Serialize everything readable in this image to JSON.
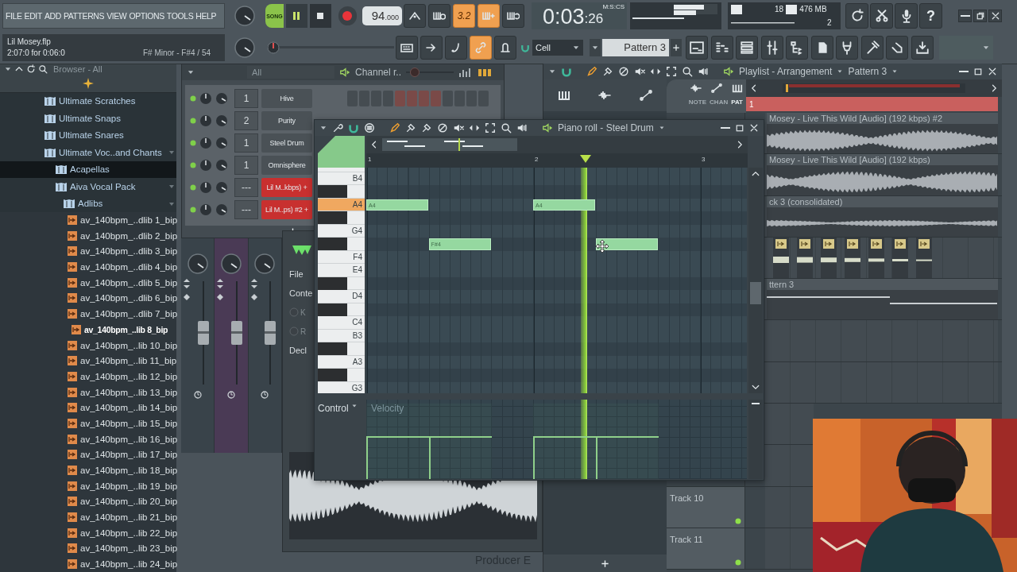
{
  "menu": [
    "FILE",
    "EDIT",
    "ADD",
    "PATTERNS",
    "VIEW",
    "OPTIONS",
    "TOOLS",
    "HELP"
  ],
  "project": {
    "file": "Lil Mosey.flp",
    "position": "2:07:0 for 0:06:0",
    "scale": "F# Minor - F#4 / 54"
  },
  "transport": {
    "mode": "SONG",
    "song_mode": true,
    "playing": true,
    "tempo": "94",
    "tempo_fraction": ".000"
  },
  "tools_top": [
    {
      "on": false
    },
    {
      "on": false
    },
    {
      "label": "3.2",
      "on": true
    },
    {
      "on": true
    },
    {
      "on": false
    }
  ],
  "tools_bottom": [
    {
      "on": false
    },
    {
      "on": false
    },
    {
      "on": false
    },
    {
      "on": true
    },
    {
      "on": false
    }
  ],
  "clock": {
    "time": "0:03",
    "centiseconds": ":26",
    "format": "M:S:CS"
  },
  "cpu": {
    "polyphony": "18",
    "memory": "476 MB",
    "processes": "2"
  },
  "help": "?",
  "pitch_slider": {
    "level": 0.0
  },
  "snap": "Cell",
  "pattern": "Pattern 3",
  "browser": {
    "title": "Browser - All",
    "tree": [
      {
        "label": "Ultimate Scratches",
        "kind": "folder",
        "selected": false
      },
      {
        "label": "Ultimate Snaps",
        "kind": "folder",
        "selected": false
      },
      {
        "label": "Ultimate Snares",
        "kind": "folder",
        "selected": false
      },
      {
        "label": "Ultimate Voc..and Chants",
        "kind": "folder",
        "selected": false,
        "expanded": true,
        "children": [
          {
            "label": "Acapellas",
            "kind": "folder",
            "selected": true
          },
          {
            "label": "Aiva Vocal Pack",
            "kind": "folder",
            "selected": false,
            "expanded": true,
            "children": [
              {
                "label": "Adlibs",
                "kind": "folder",
                "selected": false,
                "expanded": true,
                "children": [
                  {
                    "label": "av_140bpm_..dlib 1_bip",
                    "kind": "file",
                    "selected": false
                  },
                  {
                    "label": "av_140bpm_..dlib 2_bip",
                    "kind": "file",
                    "selected": false
                  },
                  {
                    "label": "av_140bpm_..dlib 3_bip",
                    "kind": "file",
                    "selected": false
                  },
                  {
                    "label": "av_140bpm_..dlib 4_bip",
                    "kind": "file",
                    "selected": false
                  },
                  {
                    "label": "av_140bpm_..dlib 5_bip",
                    "kind": "file",
                    "selected": false
                  },
                  {
                    "label": "av_140bpm_..dlib 6_bip",
                    "kind": "file",
                    "selected": false
                  },
                  {
                    "label": "av_140bpm_..dlib 7_bip",
                    "kind": "file",
                    "selected": false
                  },
                  {
                    "label": "av_140bpm_..lib 8_bip",
                    "kind": "file",
                    "selected": true
                  },
                  {
                    "label": "av_140bpm_..lib 10_bip",
                    "kind": "file",
                    "selected": false
                  },
                  {
                    "label": "av_140bpm_..lib 11_bip",
                    "kind": "file",
                    "selected": false
                  },
                  {
                    "label": "av_140bpm_..lib 12_bip",
                    "kind": "file",
                    "selected": false
                  },
                  {
                    "label": "av_140bpm_..lib 13_bip",
                    "kind": "file",
                    "selected": false
                  },
                  {
                    "label": "av_140bpm_..lib 14_bip",
                    "kind": "file",
                    "selected": false
                  },
                  {
                    "label": "av_140bpm_..lib 15_bip",
                    "kind": "file",
                    "selected": false
                  },
                  {
                    "label": "av_140bpm_..lib 16_bip",
                    "kind": "file",
                    "selected": false
                  },
                  {
                    "label": "av_140bpm_..lib 17_bip",
                    "kind": "file",
                    "selected": false
                  },
                  {
                    "label": "av_140bpm_..lib 18_bip",
                    "kind": "file",
                    "selected": false
                  },
                  {
                    "label": "av_140bpm_..lib 19_bip",
                    "kind": "file",
                    "selected": false
                  },
                  {
                    "label": "av_140bpm_..lib 20_bip",
                    "kind": "file",
                    "selected": false
                  },
                  {
                    "label": "av_140bpm_..lib 21_bip",
                    "kind": "file",
                    "selected": false
                  },
                  {
                    "label": "av_140bpm_..lib 22_bip",
                    "kind": "file",
                    "selected": false
                  },
                  {
                    "label": "av_140bpm_..lib 23_bip",
                    "kind": "file",
                    "selected": false
                  },
                  {
                    "label": "av_140bpm_..lib 24_bip",
                    "kind": "file",
                    "selected": false
                  }
                ]
              }
            ]
          }
        ]
      }
    ]
  },
  "channel_rack": {
    "filter": "All",
    "title": "Channel r..",
    "swing": {
      "level": 0.1
    },
    "channels": [
      {
        "number": "1",
        "name": "Hive",
        "kind": "instrument"
      },
      {
        "number": "2",
        "name": "Purity",
        "kind": "instrument"
      },
      {
        "number": "1",
        "name": "Steel Drum",
        "kind": "instrument"
      },
      {
        "number": "1",
        "name": "Omnisphere",
        "kind": "instrument"
      },
      {
        "number": "---",
        "name": "Lil M..kbps) +",
        "kind": "audio"
      },
      {
        "number": "---",
        "name": "Lil M..ps) #2 +",
        "kind": "audio"
      }
    ]
  },
  "plugin": {
    "labels": [
      {
        "text": "File",
        "kind": "tab"
      },
      {
        "text": "Conte",
        "kind": "tab"
      },
      {
        "text": "K",
        "kind": "radio"
      },
      {
        "text": "R",
        "kind": "radio"
      },
      {
        "text": "Decl",
        "kind": "tab"
      }
    ]
  },
  "piano_roll": {
    "title": "Piano roll - Steel Drum",
    "bars": [
      "1",
      "2",
      "3"
    ],
    "keys": [
      {
        "label": "B4",
        "selected": false
      },
      {
        "label": "A4",
        "selected": true
      },
      {
        "label": "G4",
        "selected": false
      },
      {
        "label": "F4",
        "selected": false
      },
      {
        "label": "E4",
        "selected": false
      },
      {
        "label": "D4",
        "selected": false
      },
      {
        "label": "C4",
        "selected": false
      },
      {
        "label": "B3",
        "selected": false
      },
      {
        "label": "A3",
        "selected": false
      },
      {
        "label": "G3",
        "selected": false
      }
    ],
    "notes": [
      {
        "label": "A4",
        "level": 0.57
      },
      {
        "label": "F#4",
        "level": 0.57
      },
      {
        "label": "A4",
        "level": 0.57
      },
      {
        "level": 0.57
      }
    ],
    "control": "Control",
    "lane": "Velocity"
  },
  "playlist": {
    "title": "Playlist - Arrangement",
    "pattern": "Pattern 3",
    "picker_tabs": [
      {
        "label": "NOTE",
        "selected": false
      },
      {
        "label": "CHAN",
        "selected": false
      },
      {
        "label": "PAT",
        "selected": true
      }
    ],
    "marker": "1",
    "clips": [
      {
        "kind": "audio",
        "label": "Mosey - Live This Wild [Audio] (192  kbps) #2"
      },
      {
        "kind": "audio",
        "label": "Mosey - Live This Wild [Audio] (192  kbps)"
      },
      {
        "kind": "audio",
        "label": "ck 3 (consolidated)"
      },
      {
        "kind": "samples"
      },
      {
        "kind": "pattern",
        "label": "ttern 3"
      }
    ],
    "track_names": [
      "Track 10",
      "Track 11"
    ]
  },
  "footer": "Producer E"
}
